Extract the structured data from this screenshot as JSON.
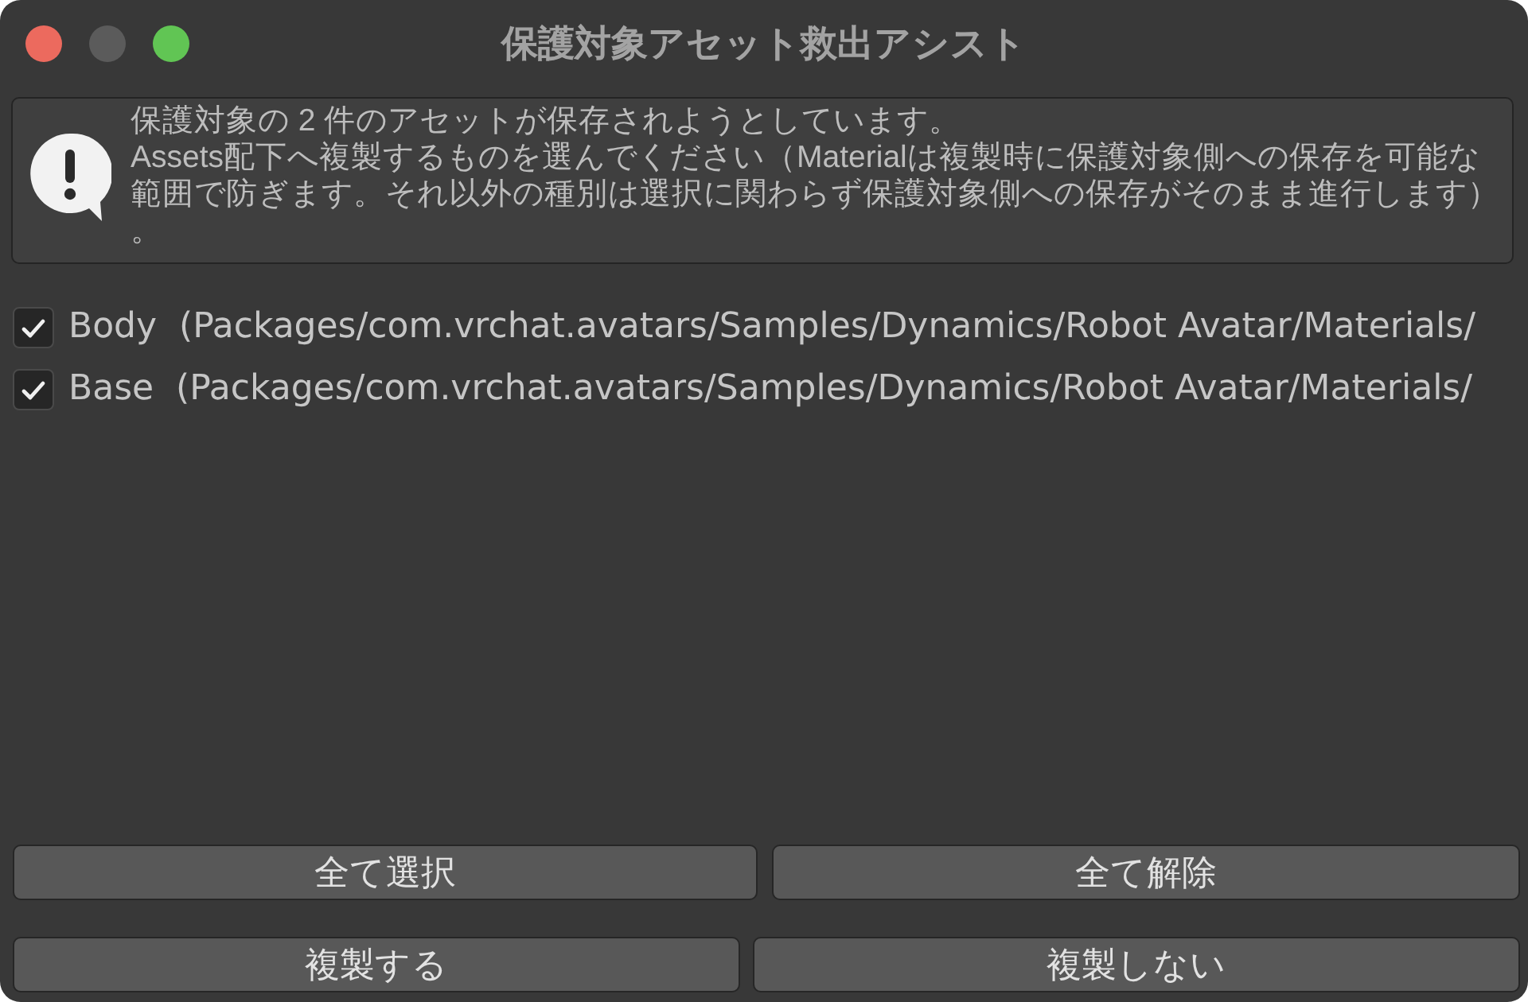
{
  "window": {
    "title": "保護対象アセット救出アシスト"
  },
  "help_box": {
    "message_lines": [
      "保護対象の 2 件のアセットが保存されようとしています。",
      "Assets配下へ複製するものを選んでください（Materialは複製時に保護対象側への保存を可能な",
      "範囲で防ぎます。それ以外の種別は選択に関わらず保護対象側への保存がそのまま進行します）",
      "。"
    ]
  },
  "assets": [
    {
      "label": "Body  (Packages/com.vrchat.avatars/Samples/Dynamics/Robot Avatar/Materials/",
      "checked": true
    },
    {
      "label": "Base  (Packages/com.vrchat.avatars/Samples/Dynamics/Robot Avatar/Materials/",
      "checked": true
    }
  ],
  "selection_buttons": [
    "全て選択",
    "全て解除"
  ],
  "action_buttons": [
    "複製する",
    "複製しない"
  ]
}
